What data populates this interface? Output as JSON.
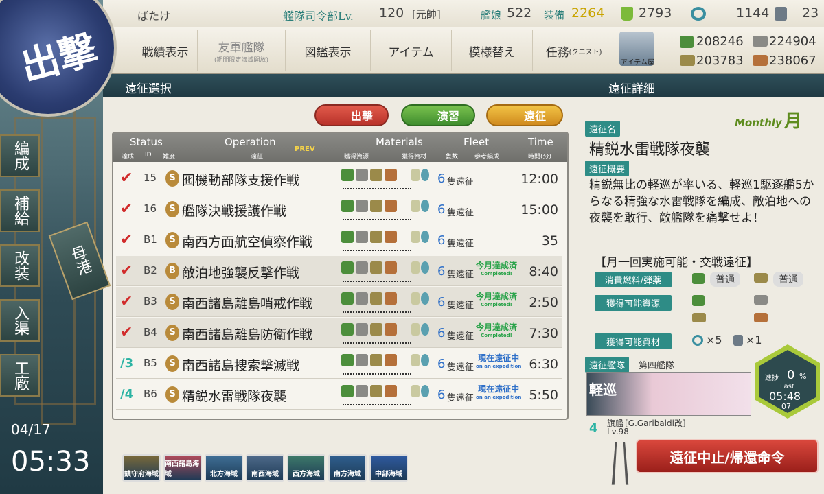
{
  "header": {
    "player_name": "ばたけ",
    "hq_label": "艦隊司令部Lv.",
    "hq_level": "120",
    "rank": "[元帥]",
    "ships_label": "艦娘",
    "ships_count": "522",
    "equip_label": "装備",
    "equip_count": "2264",
    "bucket": "2793",
    "dev_material": "1144",
    "screw": "23"
  },
  "resources": {
    "fuel": "208246",
    "ammo": "224904",
    "steel": "203783",
    "bauxite": "238067"
  },
  "menu": [
    "戦績表示",
    "友軍艦隊",
    "図鑑表示",
    "アイテム",
    "模様替え",
    "任務"
  ],
  "menu_sub": {
    "friend": "(期間限定海域開放)",
    "quest": "(クエスト)"
  },
  "item_shop_label": "アイテム屋",
  "sections": {
    "left": "遠征選択",
    "right": "遠征詳細"
  },
  "mode_buttons": [
    "出撃",
    "演習",
    "遠征"
  ],
  "list_header": {
    "status": "Status",
    "status_sub": "達成",
    "id_sub": "ID",
    "diff_sub": "難度",
    "operation": "Operation",
    "operation_sub": "遠征",
    "prev": "PREV",
    "materials": "Materials",
    "mat_sub1": "獲得資源",
    "mat_sub2": "獲得資材",
    "fleet": "Fleet",
    "fleet_sub1": "隻数",
    "fleet_sub2": "参考編成",
    "time": "Time",
    "time_sub": "時間(分)"
  },
  "expeditions": [
    {
      "id": "15",
      "diff": "S",
      "name": "囮機動部隊支援作戦",
      "fleet": "6",
      "fleet_label": "隻遠征",
      "time": "12:00",
      "status": "",
      "status_sub": "",
      "done": true
    },
    {
      "id": "16",
      "diff": "S",
      "name": "艦隊決戦援護作戦",
      "fleet": "6",
      "fleet_label": "隻遠征",
      "time": "15:00",
      "status": "",
      "status_sub": "",
      "done": true
    },
    {
      "id": "B1",
      "diff": "S",
      "name": "南西方面航空偵察作戦",
      "fleet": "6",
      "fleet_label": "隻遠征",
      "time": "35",
      "status": "",
      "status_sub": "",
      "done": true
    },
    {
      "id": "B2",
      "diff": "B",
      "name": "敵泊地強襲反撃作戦",
      "fleet": "6",
      "fleet_label": "隻遠征",
      "time": "8:40",
      "status": "今月達成済",
      "status_sub": "Completed!",
      "done": true
    },
    {
      "id": "B3",
      "diff": "S",
      "name": "南西諸島離島哨戒作戦",
      "fleet": "6",
      "fleet_label": "隻遠征",
      "time": "2:50",
      "status": "今月達成済",
      "status_sub": "Completed!",
      "done": true
    },
    {
      "id": "B4",
      "diff": "S",
      "name": "南西諸島離島防衛作戦",
      "fleet": "6",
      "fleet_label": "隻遠征",
      "time": "7:30",
      "status": "今月達成済",
      "status_sub": "Completed!",
      "done": true
    },
    {
      "id": "B5",
      "diff": "S",
      "name": "南西諸島捜索撃滅戦",
      "fleet": "6",
      "fleet_label": "隻遠征",
      "time": "6:30",
      "status": "現在遠征中",
      "status_sub": "on an expedition",
      "done": false,
      "fleet_no": "3"
    },
    {
      "id": "B6",
      "diff": "S",
      "name": "精鋭水雷戦隊夜襲",
      "fleet": "6",
      "fleet_label": "隻遠征",
      "time": "5:50",
      "status": "現在遠征中",
      "status_sub": "on an expedition",
      "done": false,
      "fleet_no": "4"
    }
  ],
  "detail": {
    "name_label": "遠征名",
    "monthly": "Monthly",
    "monthly_kanji": "月",
    "name": "精鋭水雷戦隊夜襲",
    "summary_label": "遠征概要",
    "summary": "精鋭無比の軽巡が率いる、軽巡1駆逐艦5からなる精強な水雷戦隊を編成、敵泊地への夜襲を敢行、敵艦隊を痛撃せよ！",
    "note": "【月一回実施可能・交戦遠征】",
    "consume_label": "消費燃料/弾薬",
    "consume_fuel": "普通",
    "consume_ammo": "普通",
    "resources_label": "獲得可能資源",
    "items_label": "獲得可能資材",
    "item1": "×5",
    "item2": "×1",
    "fleet_label": "遠征艦隊",
    "fleet_name": "第四艦隊",
    "flagship_label": "旗艦",
    "flagship_name": "[G.Garibaldi改]",
    "flagship_level": "Lv.98",
    "ship_type": "軽巡",
    "fleet_no": "4",
    "progress_label": "進捗",
    "progress": "0",
    "progress_unit": "%",
    "last_label": "Last",
    "last_time": "05:48",
    "last_sec": "07",
    "recall_button": "遠征中止/帰還命令"
  },
  "sidebar": {
    "sortie": "出撃",
    "buttons": [
      "編成",
      "補給",
      "改装",
      "入渠",
      "工廠"
    ],
    "port": "母港"
  },
  "clock": {
    "date": "04/17",
    "time": "05:33"
  },
  "regions": [
    "鎮守府海域",
    "南西諸島海域",
    "北方海域",
    "南西海域",
    "西方海域",
    "南方海域",
    "中部海域"
  ]
}
